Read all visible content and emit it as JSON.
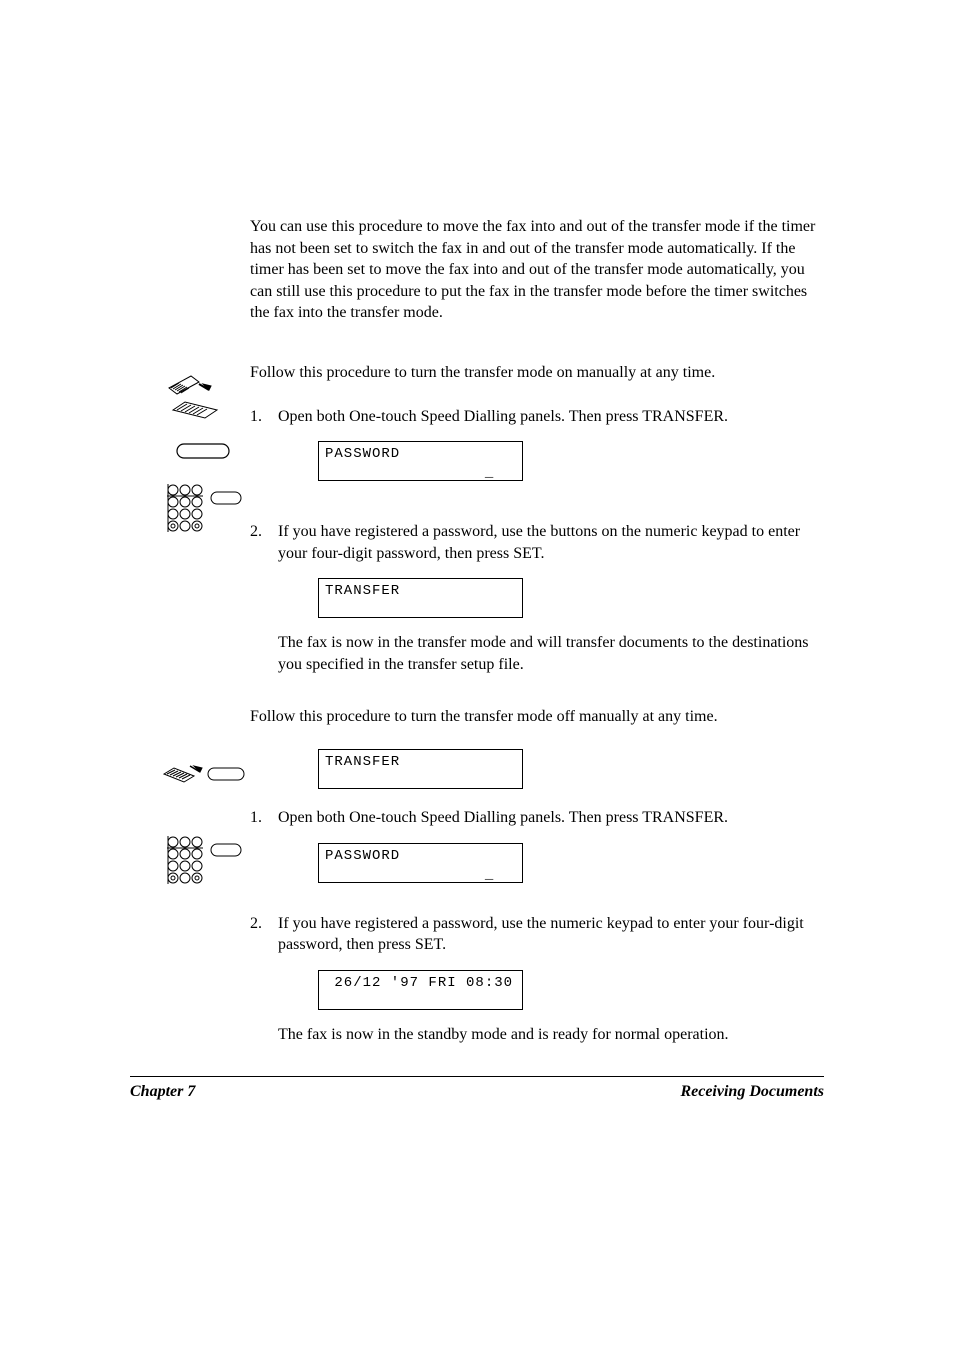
{
  "intro_paragraph": "You can use this procedure to move the fax into and out of the transfer mode if the timer has not been set to switch the fax in and out of the transfer mode automatically. If the timer has been set to move the fax into and out of the transfer mode automatically, you can still use this procedure to put the fax in the transfer mode before the timer switches the fax into the transfer mode.",
  "section_on": {
    "intro": "Follow this procedure to turn the transfer mode on manually at any time.",
    "step1": {
      "num": "1.",
      "text": "Open both One-touch Speed Dialling panels. Then press TRANSFER.",
      "lcd": "PASSWORD\n                 _"
    },
    "step2": {
      "num": "2.",
      "text": "If you have registered a password, use the buttons on the numeric keypad to enter your four-digit password, then press SET.",
      "lcd": "TRANSFER\n ",
      "post": "The fax is now in the transfer mode and will transfer documents to the destinations you specified in the transfer setup file."
    }
  },
  "section_off": {
    "intro": "Follow this procedure to turn the transfer mode off manually at any time.",
    "lcd_pre": "TRANSFER\n ",
    "step1": {
      "num": "1.",
      "text": "Open both One-touch Speed Dialling panels. Then press TRANSFER.",
      "lcd": "PASSWORD\n                 _"
    },
    "step2": {
      "num": "2.",
      "text": "If you have registered a password, use the numeric keypad to enter your four-digit password, then press SET.",
      "lcd": " 26/12 '97 FRI 08:30\n ",
      "post": "The fax is now in the standby mode and is ready for normal operation."
    }
  },
  "footer": {
    "left": "Chapter 7",
    "right": "Receiving Documents"
  }
}
